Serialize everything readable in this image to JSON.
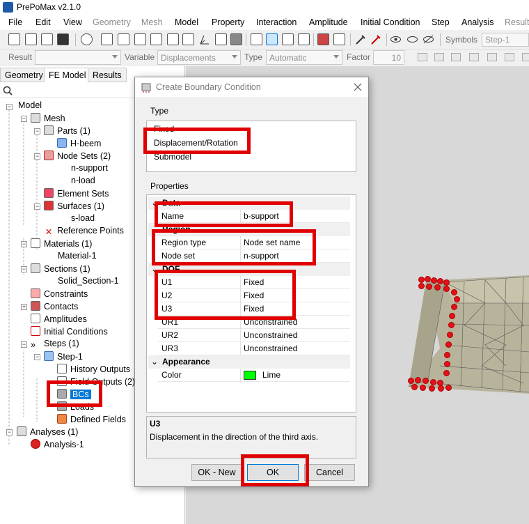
{
  "window": {
    "title": "PrePoMax v2.1.0"
  },
  "menu": [
    {
      "label": "File",
      "enabled": true
    },
    {
      "label": "Edit",
      "enabled": true
    },
    {
      "label": "View",
      "enabled": true
    },
    {
      "label": "Geometry",
      "enabled": false
    },
    {
      "label": "Mesh",
      "enabled": false
    },
    {
      "label": "Model",
      "enabled": true
    },
    {
      "label": "Property",
      "enabled": true
    },
    {
      "label": "Interaction",
      "enabled": true
    },
    {
      "label": "Amplitude",
      "enabled": true
    },
    {
      "label": "Initial Condition",
      "enabled": true
    },
    {
      "label": "Step",
      "enabled": true
    },
    {
      "label": "Analysis",
      "enabled": true
    },
    {
      "label": "Results",
      "enabled": false
    }
  ],
  "toolbar1": {
    "symbols_label": "Symbols",
    "step_value": "Step-1"
  },
  "toolbar2": {
    "result_label": "Result",
    "result_value": "",
    "variable_label": "Variable",
    "variable_value": "Displacements",
    "type_label": "Type",
    "type_value": "Automatic",
    "factor_label": "Factor",
    "factor_value": "10"
  },
  "left_tabs": [
    {
      "label": "Geometry",
      "active": false
    },
    {
      "label": "FE Model",
      "active": true
    },
    {
      "label": "Results",
      "active": false
    }
  ],
  "tree": {
    "model": "Model",
    "mesh": "Mesh",
    "parts": "Parts (1)",
    "h_beem": "H-beem",
    "node_sets": "Node Sets (2)",
    "n_support": "n-support",
    "n_load": "n-load",
    "element_sets": "Element Sets",
    "surfaces": "Surfaces (1)",
    "s_load": "s-load",
    "reference_points": "Reference Points",
    "materials": "Materials (1)",
    "material_1": "Material-1",
    "sections": "Sections (1)",
    "solid_section_1": "Solid_Section-1",
    "constraints": "Constraints",
    "contacts": "Contacts",
    "amplitudes": "Amplitudes",
    "initial_conditions": "Initial Conditions",
    "steps": "Steps (1)",
    "step_1": "Step-1",
    "history_outputs": "History Outputs",
    "field_outputs": "Field Outputs (2)",
    "bcs": "BCs",
    "loads": "Loads",
    "defined_fields": "Defined Fields",
    "analyses": "Analyses (1)",
    "analysis_1": "Analysis-1"
  },
  "dialog": {
    "title": "Create Boundary Condition",
    "type_group_label": "Type",
    "type_options": [
      "Fixed",
      "Displacement/Rotation",
      "Submodel"
    ],
    "selected_type": "Displacement/Rotation",
    "properties_group_label": "Properties",
    "categories": {
      "data": "Data",
      "region": "Region",
      "dof": "DOF",
      "appearance": "Appearance"
    },
    "properties": {
      "name": {
        "key": "Name",
        "value": "b-support"
      },
      "region_type": {
        "key": "Region type",
        "value": "Node set name"
      },
      "node_set": {
        "key": "Node set",
        "value": "n-support"
      },
      "u1": {
        "key": "U1",
        "value": "Fixed"
      },
      "u2": {
        "key": "U2",
        "value": "Fixed"
      },
      "u3": {
        "key": "U3",
        "value": "Fixed"
      },
      "ur1": {
        "key": "UR1",
        "value": "Unconstrained"
      },
      "ur2": {
        "key": "UR2",
        "value": "Unconstrained"
      },
      "ur3": {
        "key": "UR3",
        "value": "Unconstrained"
      },
      "color": {
        "key": "Color",
        "value": "Lime",
        "swatch": "#00ff00"
      }
    },
    "description": {
      "title": "U3",
      "text": "Displacement in the direction of the third axis."
    },
    "buttons": {
      "ok_new": "OK - New",
      "ok": "OK",
      "cancel": "Cancel"
    }
  },
  "colors": {
    "highlight_red": "#e00000",
    "selection_blue": "#0078d7",
    "node_red": "#e4101a",
    "mesh_fill": "#b8b49c",
    "viewport_bg": "#d8d8d8"
  }
}
